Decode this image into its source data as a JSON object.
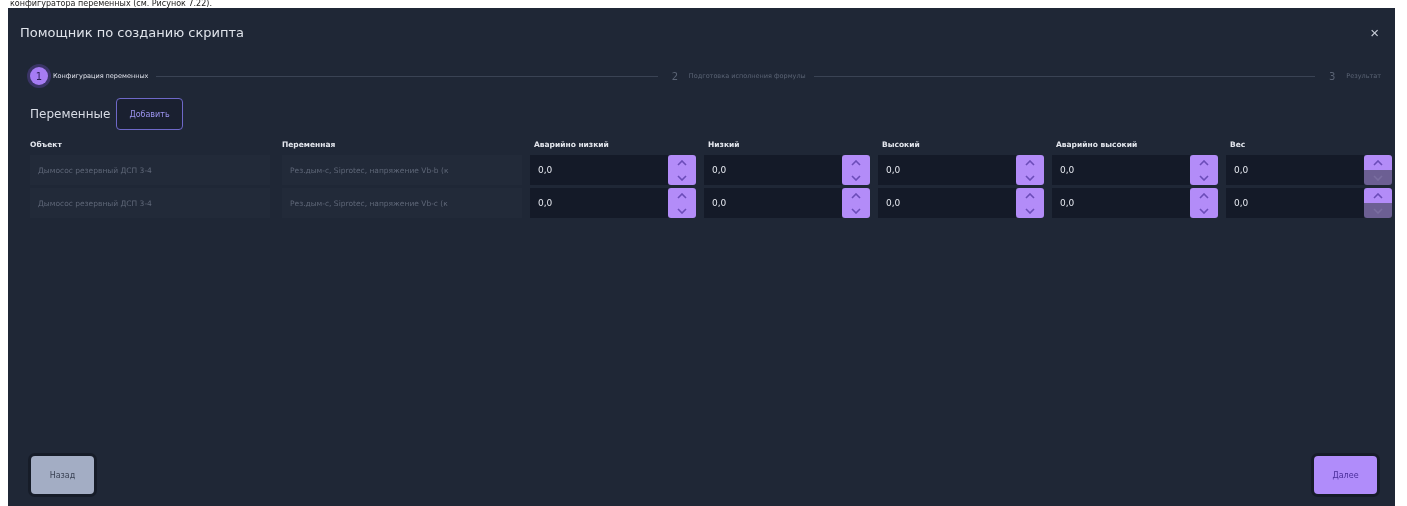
{
  "caption": "конфигуратора переменных (см. Рисунок 7.22).",
  "window": {
    "title": "Помощник по созданию скрипта",
    "close": "×"
  },
  "steps": [
    {
      "number": "1",
      "label": "Конфигурация переменных",
      "active": true
    },
    {
      "number": "2",
      "label": "Подготовка исполнения формулы",
      "active": false
    },
    {
      "number": "3",
      "label": "Результат",
      "active": false
    }
  ],
  "variables": {
    "label": "Переменные",
    "add_button": "Добавить"
  },
  "table": {
    "columns": [
      "Объект",
      "Переменная",
      "Аварийно низкий",
      "Низкий",
      "Высокий",
      "Аварийно высокий",
      "Вес"
    ],
    "rows": [
      {
        "object": "Дымосос резервный ДСП 3-4",
        "variable": "Рез.дым-с, Siprotec, напряжение Vb-b (к",
        "values": [
          {
            "value": "0,0",
            "down_disabled": false
          },
          {
            "value": "0,0",
            "down_disabled": false
          },
          {
            "value": "0,0",
            "down_disabled": false
          },
          {
            "value": "0,0",
            "down_disabled": false
          },
          {
            "value": "0,0",
            "down_disabled": true
          }
        ]
      },
      {
        "object": "Дымосос резервный ДСП 3-4",
        "variable": "Рез.дым-с, Siprotec, напряжение Vb-c (к",
        "values": [
          {
            "value": "0,0",
            "down_disabled": false
          },
          {
            "value": "0,0",
            "down_disabled": false
          },
          {
            "value": "0,0",
            "down_disabled": false
          },
          {
            "value": "0,0",
            "down_disabled": false
          },
          {
            "value": "0,0",
            "down_disabled": true
          }
        ]
      }
    ]
  },
  "footer": {
    "back": "Назад",
    "next": "Далее"
  }
}
